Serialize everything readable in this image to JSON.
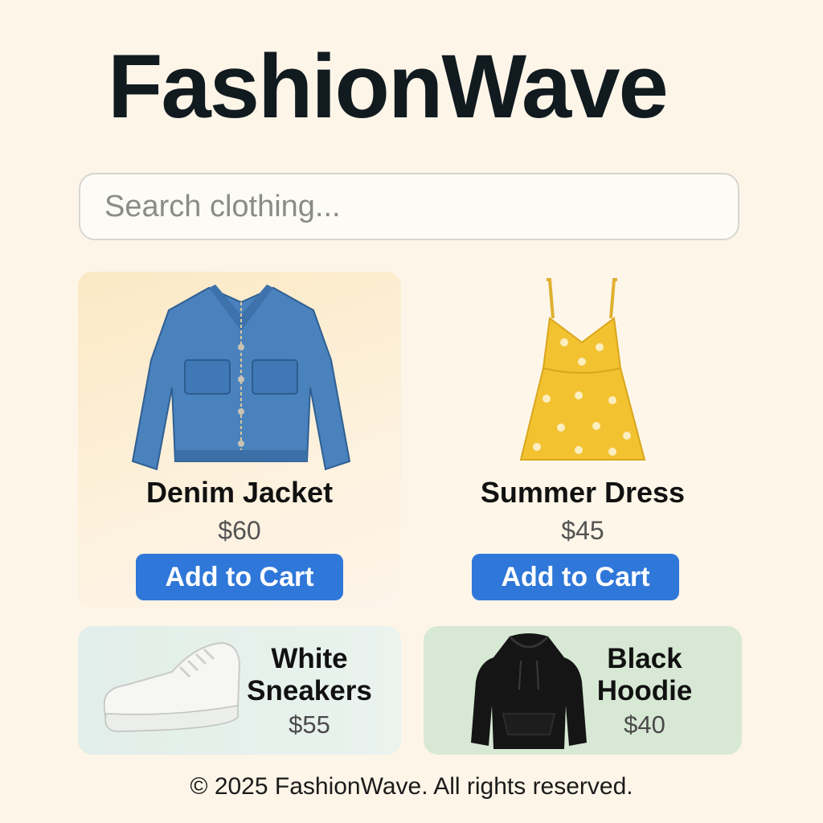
{
  "brand": {
    "name": "FashionWave"
  },
  "search": {
    "placeholder": "Search clothing..."
  },
  "products": [
    {
      "name": "Denim Jacket",
      "price": "$60",
      "button": "Add to Cart",
      "icon": "denim-jacket-image"
    },
    {
      "name": "Summer Dress",
      "price": "$45",
      "button": "Add to Cart",
      "icon": "summer-dress-image"
    },
    {
      "name_line1": "White",
      "name_line2": "Sneakers",
      "price": "$55",
      "icon": "white-sneaker-image"
    },
    {
      "name_line1": "Black",
      "name_line2": "Hoodie",
      "price": "$40",
      "icon": "black-hoodie-image"
    }
  ],
  "footer": {
    "text": "© 2025 FashionWave. All rights reserved."
  },
  "colors": {
    "accent": "#2f77d8",
    "background": "#fdf5e8",
    "text": "#111a1f"
  }
}
